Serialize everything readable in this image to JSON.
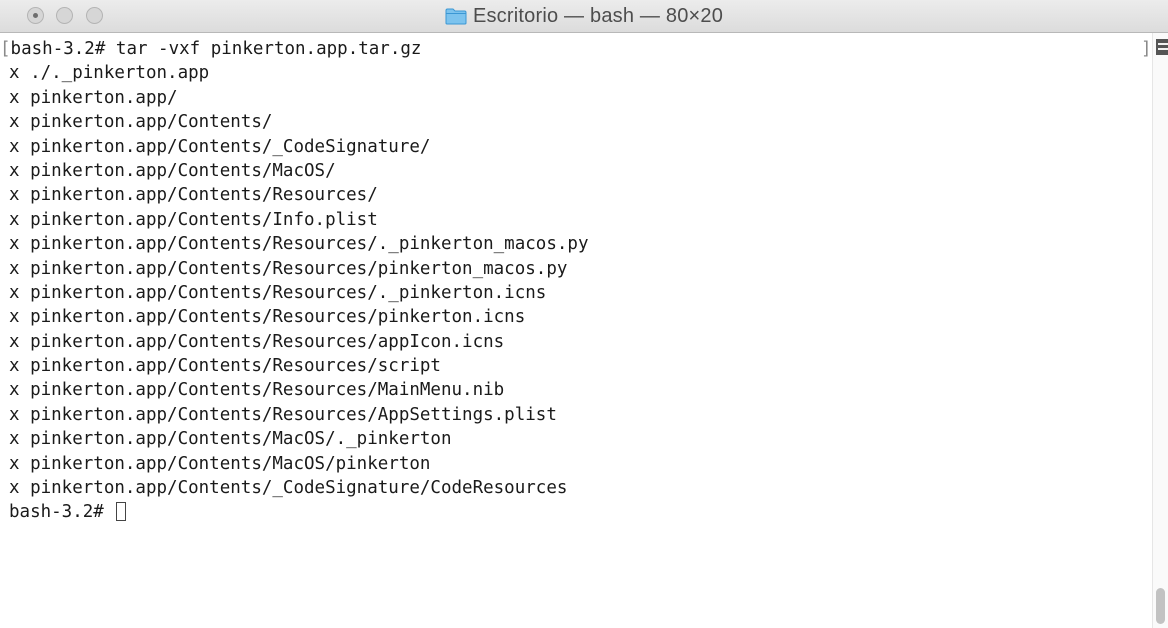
{
  "window": {
    "title": "Escritorio — bash — 80×20"
  },
  "terminal": {
    "lines": [
      "bash-3.2# tar -vxf pinkerton.app.tar.gz",
      "x ./._pinkerton.app",
      "x pinkerton.app/",
      "x pinkerton.app/Contents/",
      "x pinkerton.app/Contents/_CodeSignature/",
      "x pinkerton.app/Contents/MacOS/",
      "x pinkerton.app/Contents/Resources/",
      "x pinkerton.app/Contents/Info.plist",
      "x pinkerton.app/Contents/Resources/._pinkerton_macos.py",
      "x pinkerton.app/Contents/Resources/pinkerton_macos.py",
      "x pinkerton.app/Contents/Resources/._pinkerton.icns",
      "x pinkerton.app/Contents/Resources/pinkerton.icns",
      "x pinkerton.app/Contents/Resources/appIcon.icns",
      "x pinkerton.app/Contents/Resources/script",
      "x pinkerton.app/Contents/Resources/MainMenu.nib",
      "x pinkerton.app/Contents/Resources/AppSettings.plist",
      "x pinkerton.app/Contents/MacOS/._pinkerton",
      "x pinkerton.app/Contents/MacOS/pinkerton",
      "x pinkerton.app/Contents/_CodeSignature/CodeResources"
    ],
    "prompt": "bash-3.2# ",
    "open_bracket": "[",
    "close_bracket": "]"
  },
  "icons": {
    "folder": "folder-icon",
    "mark": "marks-list-icon"
  },
  "colors": {
    "folder_blue": "#4aa8e0",
    "text": "#1a1a1a",
    "titlebar": "#e4e4e4"
  }
}
